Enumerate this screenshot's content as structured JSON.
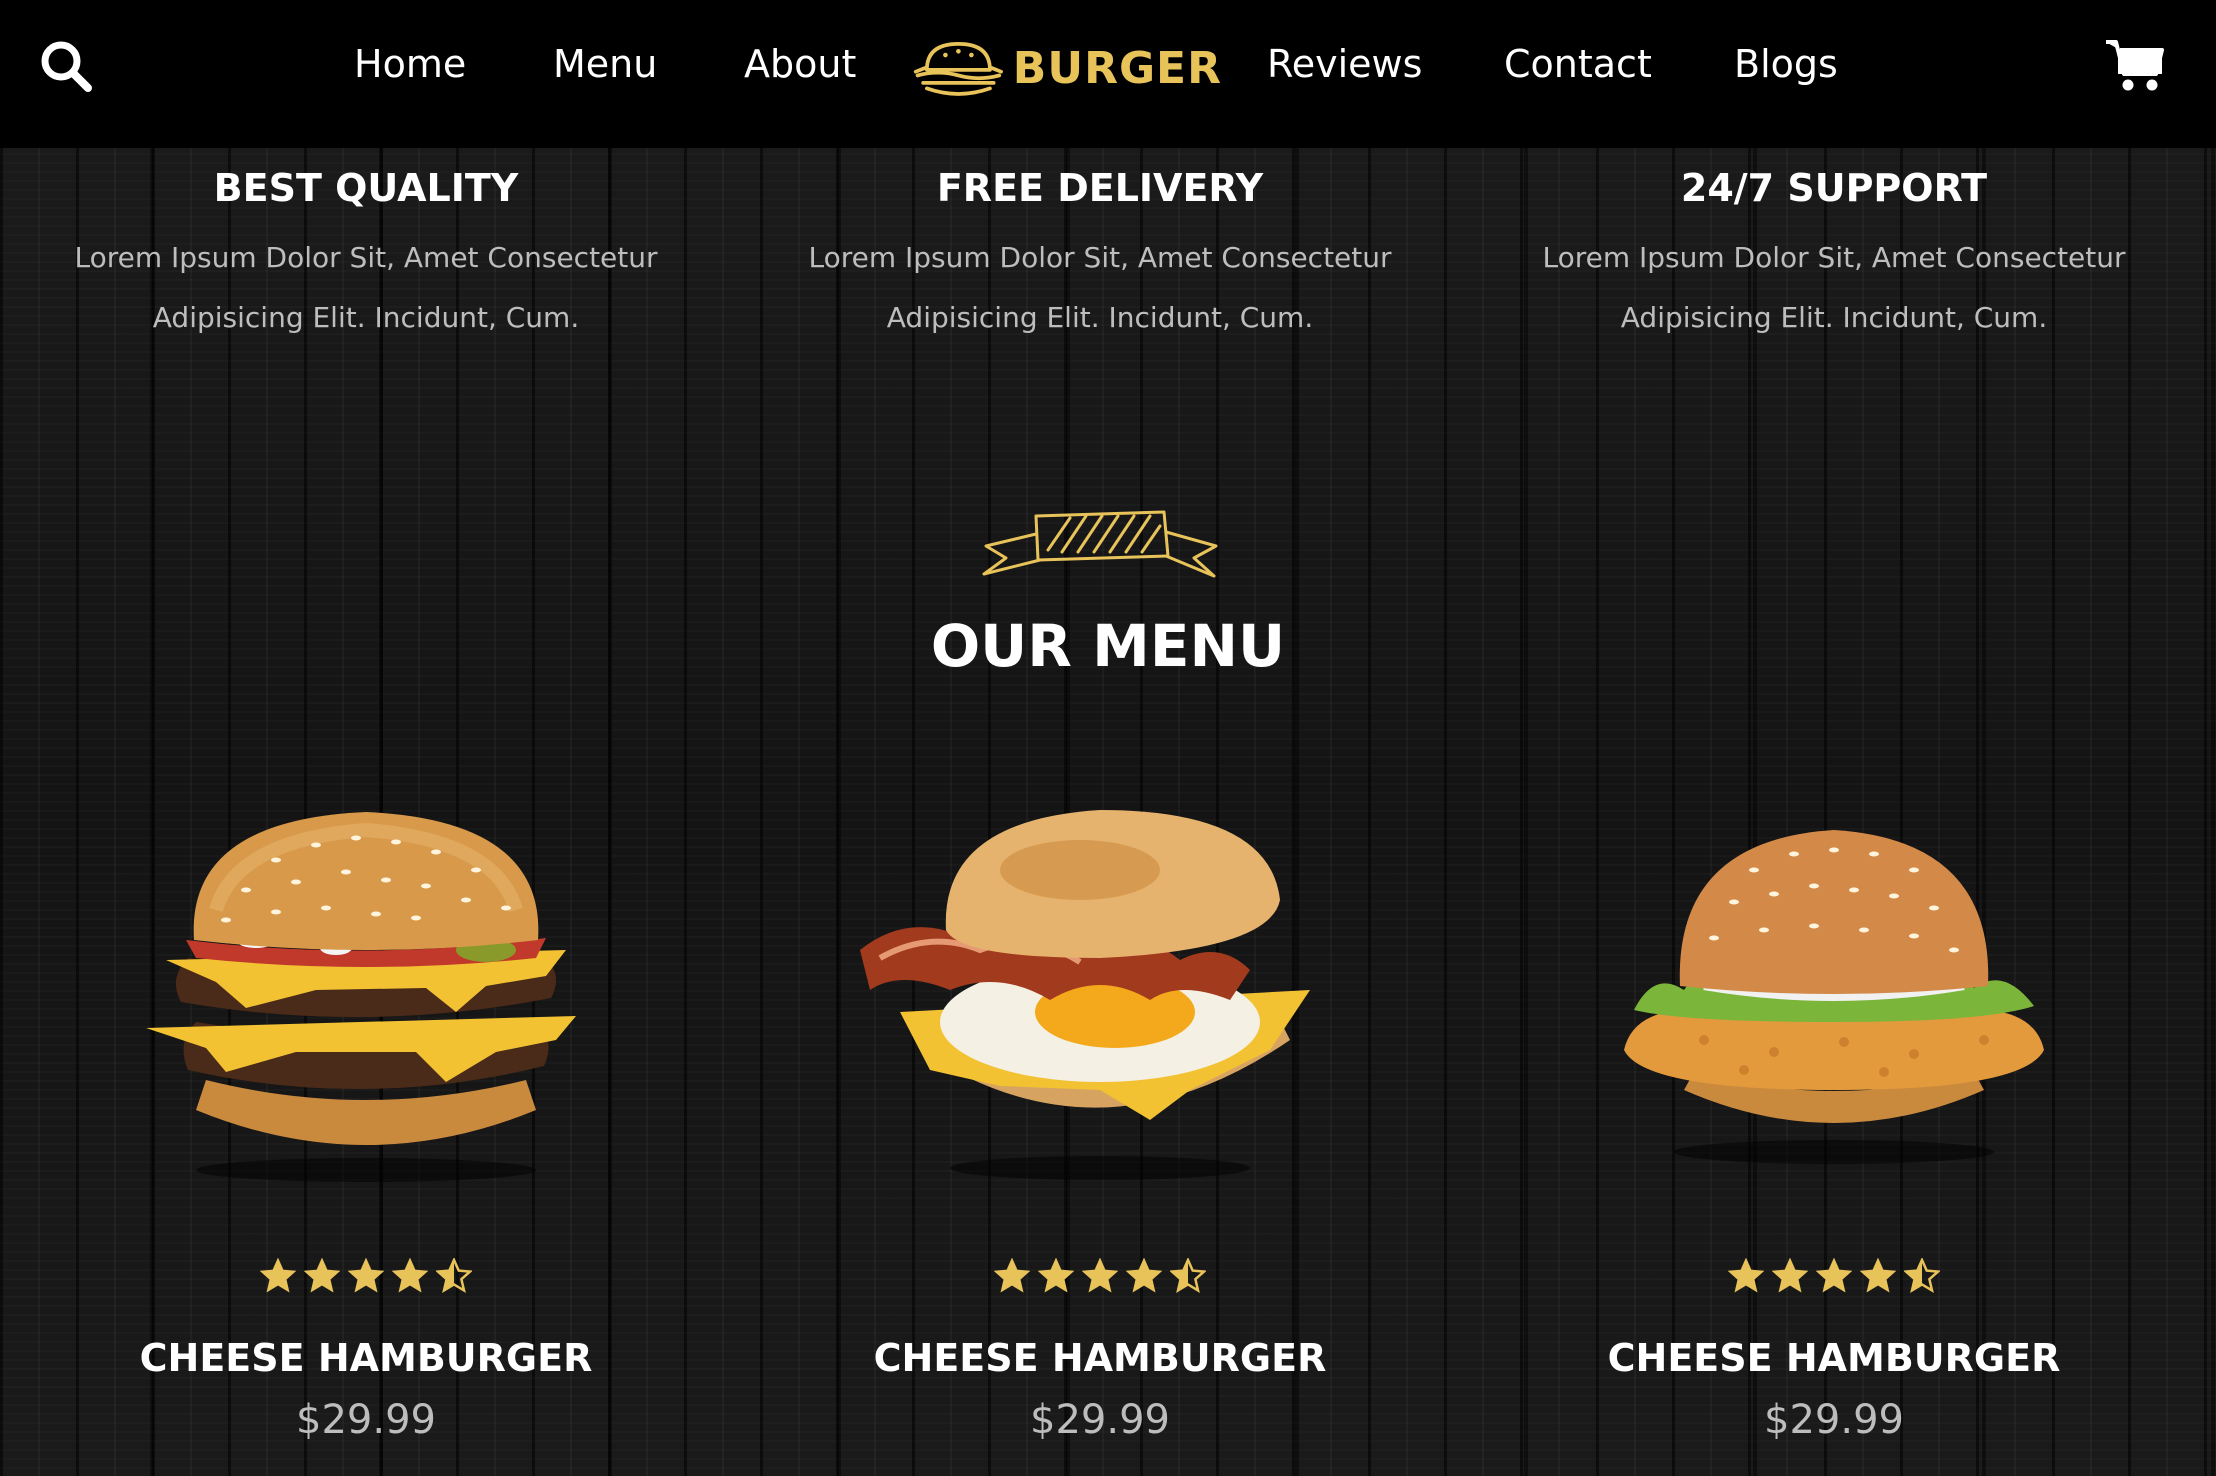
{
  "header": {
    "logo_text": "BURGER",
    "nav": [
      "Home",
      "Menu",
      "About",
      "Reviews",
      "Contact",
      "Blogs"
    ],
    "icons": {
      "search": "search-icon",
      "cart": "cart-icon",
      "logo": "burger-logo-icon"
    }
  },
  "features": [
    {
      "title": "BEST QUALITY",
      "line1": "Lorem Ipsum Dolor Sit, Amet Consectetur",
      "line2": "Adipisicing Elit. Incidunt, Cum."
    },
    {
      "title": "FREE DELIVERY",
      "line1": "Lorem Ipsum Dolor Sit, Amet Consectetur",
      "line2": "Adipisicing Elit. Incidunt, Cum."
    },
    {
      "title": "24/7 SUPPORT",
      "line1": "Lorem Ipsum Dolor Sit, Amet Consectetur",
      "line2": "Adipisicing Elit. Incidunt, Cum."
    }
  ],
  "menu_section": {
    "title": "OUR MENU",
    "icon": "ribbon-banner-icon"
  },
  "menu_items": [
    {
      "name": "CHEESE HAMBURGER",
      "price": "$29.99",
      "rating": 4.5,
      "image": "double-cheeseburger"
    },
    {
      "name": "CHEESE HAMBURGER",
      "price": "$29.99",
      "rating": 4.5,
      "image": "bacon-egg-muffin"
    },
    {
      "name": "CHEESE HAMBURGER",
      "price": "$29.99",
      "rating": 4.5,
      "image": "chicken-burger"
    }
  ],
  "colors": {
    "accent": "#e8c35a",
    "background": "#171717",
    "header": "#000000",
    "muted_text": "#bdbdbd"
  }
}
